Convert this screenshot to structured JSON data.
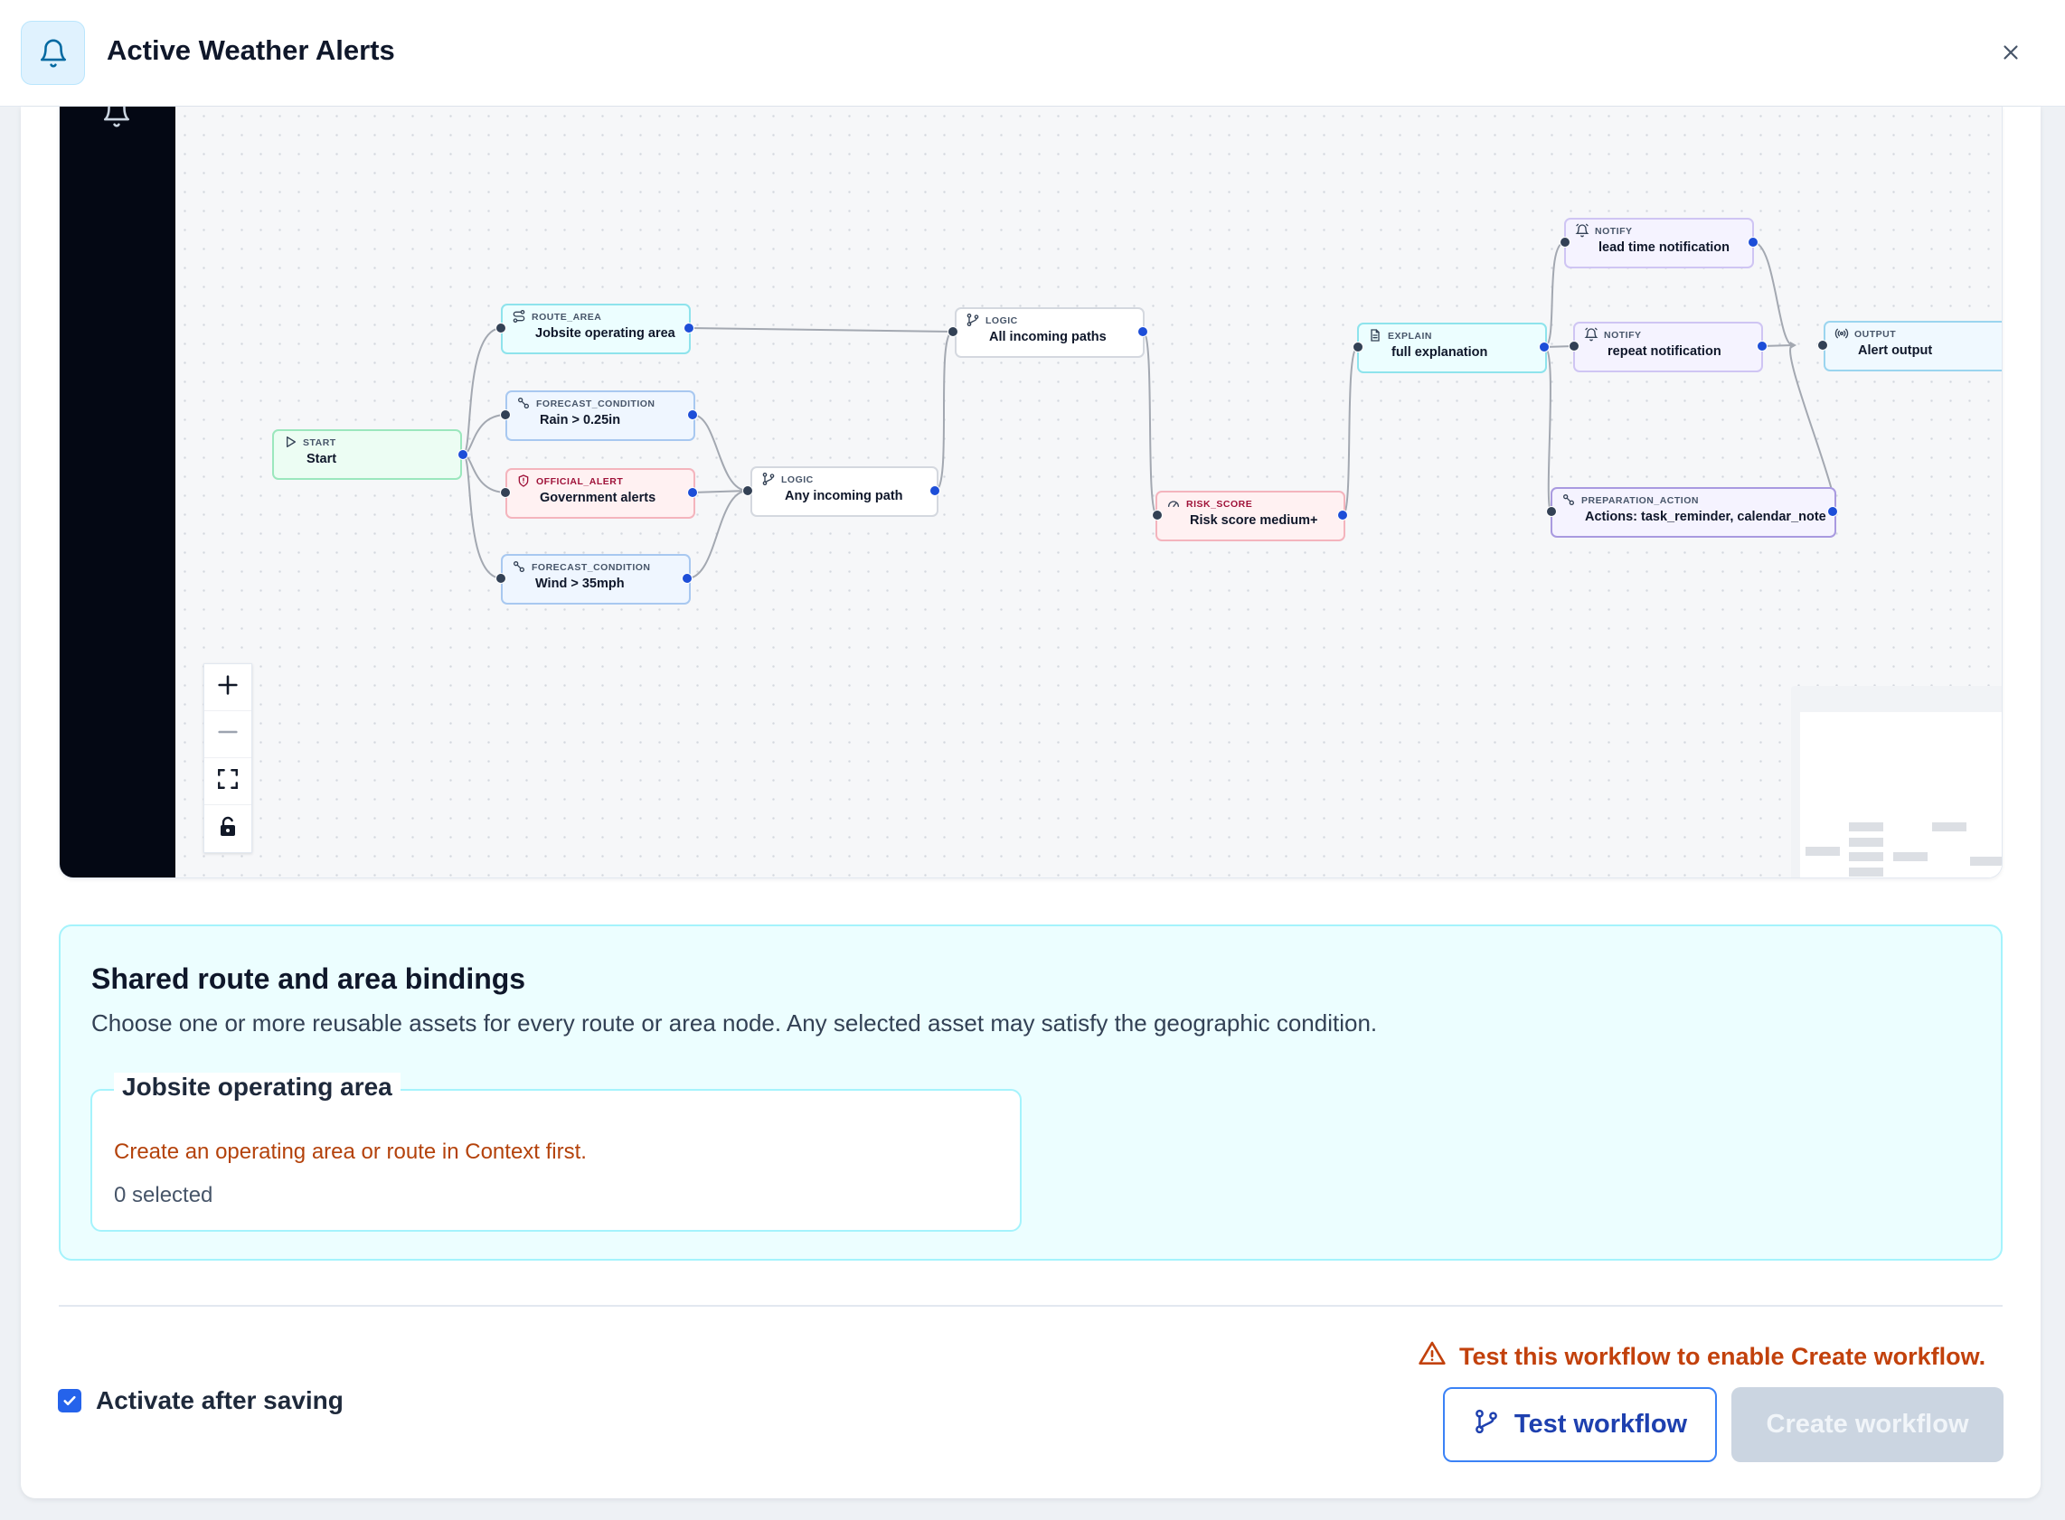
{
  "header": {
    "title": "Active Weather Alerts",
    "icon": "bell-icon",
    "close_icon": "close-icon"
  },
  "sidebar": {
    "icon": "bell-icon",
    "background": "#040814"
  },
  "workflow": {
    "nodes": {
      "start": {
        "type": "START",
        "label": "Start",
        "icon": "play-icon"
      },
      "route_area": {
        "type": "ROUTE_AREA",
        "label": "Jobsite operating area",
        "icon": "route-icon"
      },
      "rain": {
        "type": "FORECAST_CONDITION",
        "label": "Rain > 0.25in",
        "icon": "condition-icon"
      },
      "gov_alerts": {
        "type": "OFFICIAL_ALERT",
        "label": "Government alerts",
        "icon": "shield-icon"
      },
      "wind": {
        "type": "FORECAST_CONDITION",
        "label": "Wind > 35mph",
        "icon": "condition-icon"
      },
      "logic_any": {
        "type": "LOGIC",
        "label": "Any incoming path",
        "icon": "branch-icon"
      },
      "logic_all": {
        "type": "LOGIC",
        "label": "All incoming paths",
        "icon": "branch-icon"
      },
      "risk": {
        "type": "RISK_SCORE",
        "label": "Risk score medium+",
        "icon": "gauge-icon"
      },
      "explain": {
        "type": "EXPLAIN",
        "label": "full explanation",
        "icon": "document-icon"
      },
      "notify_lead": {
        "type": "NOTIFY",
        "label": "lead time notification",
        "icon": "alarm-bell-icon"
      },
      "notify_repeat": {
        "type": "NOTIFY",
        "label": "repeat notification",
        "icon": "alarm-bell-icon"
      },
      "prep": {
        "type": "PREPARATION_ACTION",
        "label": "Actions: task_reminder, calendar_note",
        "icon": "condition-icon"
      },
      "output": {
        "type": "OUTPUT",
        "label": "Alert output",
        "icon": "broadcast-icon"
      }
    }
  },
  "canvas_controls": {
    "zoom_in": "plus-icon",
    "zoom_out": "minus-icon",
    "fit_view": "fit-view-icon",
    "lock": "lock-icon"
  },
  "bindings": {
    "title": "Shared route and area bindings",
    "description": "Choose one or more reusable assets for every route or area node. Any selected asset may satisfy the geographic condition.",
    "group": {
      "legend": "Jobsite operating area",
      "warning": "Create an operating area or route in Context first.",
      "selected": "0 selected"
    }
  },
  "footer": {
    "activate_label": "Activate after saving",
    "activate_checked": true,
    "enable_warning": "Test this workflow to enable Create workflow.",
    "test_button": "Test workflow",
    "create_button": "Create workflow"
  },
  "colors": {
    "accent": "#2563eb",
    "warning": "#c2410c",
    "binding_bg": "#ecfeff",
    "handle_out": "#1d4ed8"
  }
}
